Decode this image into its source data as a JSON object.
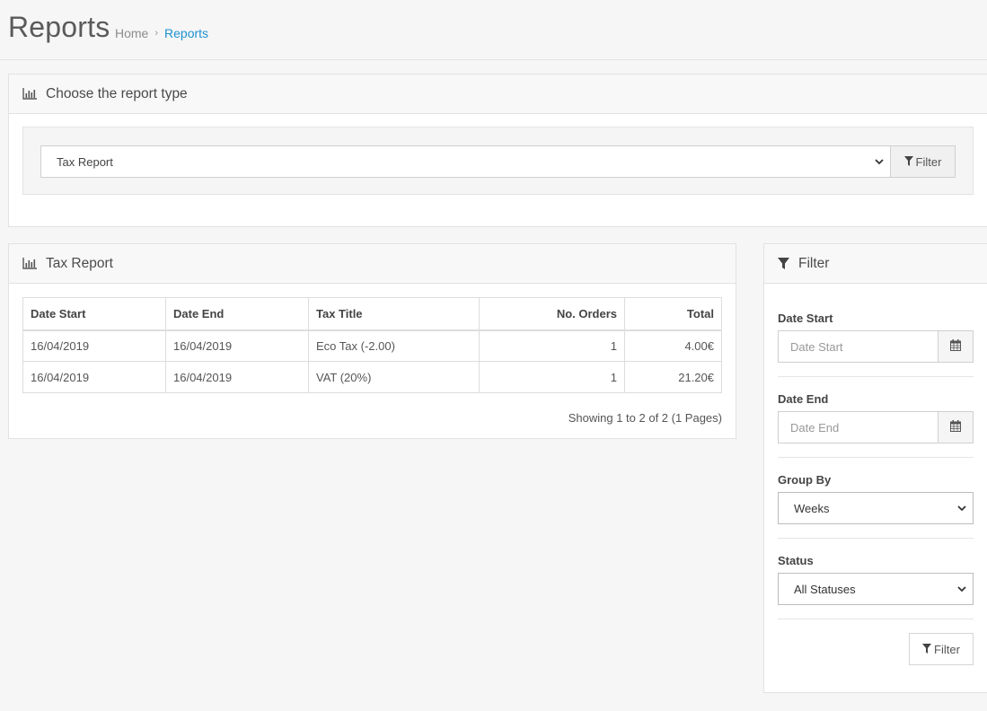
{
  "header": {
    "title": "Reports",
    "breadcrumb": [
      {
        "label": "Home"
      },
      {
        "label": "Reports"
      }
    ],
    "breadcrumb_separator": "›"
  },
  "choose_panel": {
    "title": "Choose the report type",
    "icon": "bar-chart-icon",
    "selected_report": "Tax Report",
    "filter_button_label": "Filter"
  },
  "report_panel": {
    "title": "Tax Report",
    "icon": "bar-chart-icon",
    "columns": [
      "Date Start",
      "Date End",
      "Tax Title",
      "No. Orders",
      "Total"
    ],
    "rows": [
      {
        "date_start": "16/04/2019",
        "date_end": "16/04/2019",
        "tax_title": "Eco Tax (-2.00)",
        "orders": "1",
        "total": "4.00€"
      },
      {
        "date_start": "16/04/2019",
        "date_end": "16/04/2019",
        "tax_title": "VAT (20%)",
        "orders": "1",
        "total": "21.20€"
      }
    ],
    "pagination_text": "Showing 1 to 2 of 2 (1 Pages)"
  },
  "filter_panel": {
    "title": "Filter",
    "icon": "filter-icon",
    "date_start_label": "Date Start",
    "date_start_placeholder": "Date Start",
    "date_end_label": "Date End",
    "date_end_placeholder": "Date End",
    "group_by_label": "Group By",
    "group_by_value": "Weeks",
    "status_label": "Status",
    "status_value": "All Statuses",
    "filter_button_label": "Filter"
  },
  "colors": {
    "link": "#1e91cf",
    "background": "#f6f6f6",
    "panel_heading": "#f8f8f8"
  }
}
